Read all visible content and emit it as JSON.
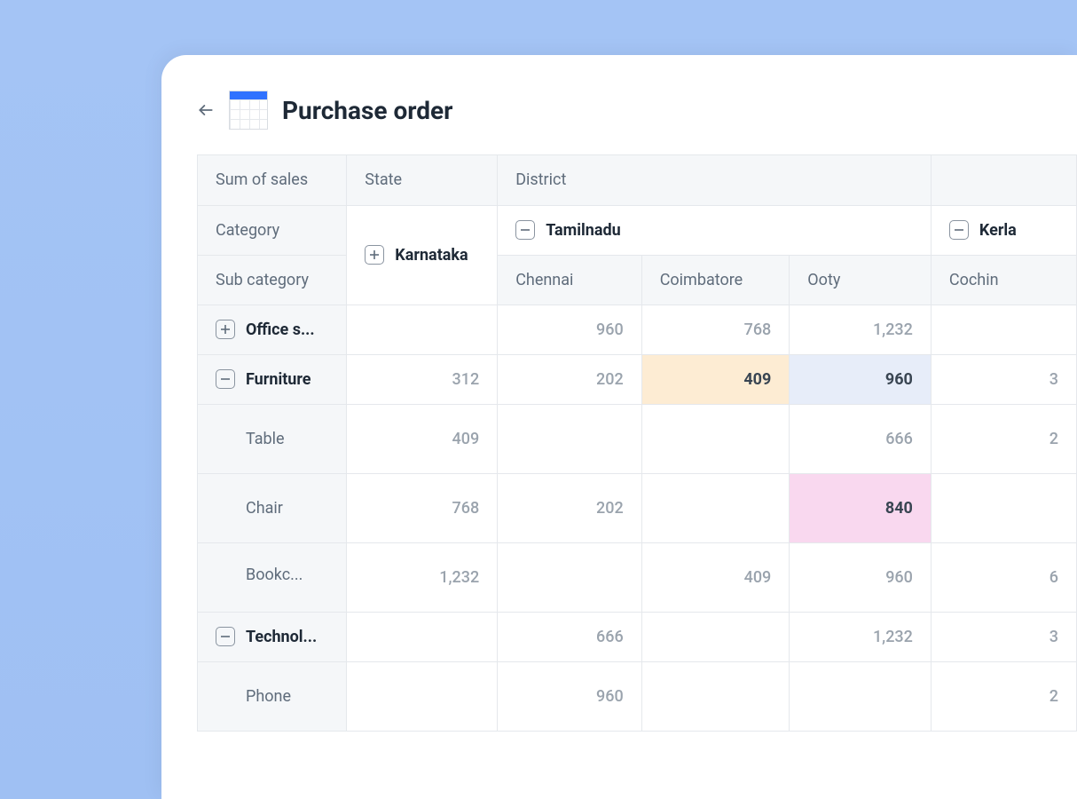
{
  "header": {
    "title": "Purchase order"
  },
  "pivot": {
    "measure_label": "Sum of sales",
    "col_axis_top": "State",
    "col_axis_sub": "District",
    "row_axis_top": "Category",
    "row_axis_sub": "Sub category",
    "col_groups": [
      {
        "name": "Karnataka",
        "expanded": false,
        "districts": []
      },
      {
        "name": "Tamilnadu",
        "expanded": true,
        "districts": [
          "Chennai",
          "Coimbatore",
          "Ooty"
        ]
      },
      {
        "name": "Kerla",
        "expanded": true,
        "districts": [
          "Cochin"
        ]
      }
    ],
    "rows": [
      {
        "category": "Office s...",
        "expanded": false,
        "values": {
          "Karnataka": "",
          "Chennai": "960",
          "Coimbatore": "768",
          "Ooty": "1,232",
          "Cochin": ""
        },
        "children": []
      },
      {
        "category": "Furniture",
        "expanded": true,
        "values": {
          "Karnataka": "312",
          "Chennai": "202",
          "Coimbatore": "409",
          "Ooty": "960",
          "Cochin": "3"
        },
        "highlights": {
          "Coimbatore": "orange",
          "Ooty": "blue"
        },
        "children": [
          {
            "name": "Table",
            "values": {
              "Karnataka": "409",
              "Chennai": "",
              "Coimbatore": "",
              "Ooty": "666",
              "Cochin": "2"
            }
          },
          {
            "name": "Chair",
            "values": {
              "Karnataka": "768",
              "Chennai": "202",
              "Coimbatore": "",
              "Ooty": "840",
              "Cochin": ""
            },
            "highlights": {
              "Ooty": "pink"
            }
          },
          {
            "name": "Bookc...",
            "values": {
              "Karnataka": "1,232",
              "Chennai": "",
              "Coimbatore": "409",
              "Ooty": "960",
              "Cochin": "6"
            }
          }
        ]
      },
      {
        "category": "Technol...",
        "expanded": true,
        "values": {
          "Karnataka": "",
          "Chennai": "666",
          "Coimbatore": "",
          "Ooty": "1,232",
          "Cochin": "3"
        },
        "children": [
          {
            "name": "Phone",
            "values": {
              "Karnataka": "",
              "Chennai": "960",
              "Coimbatore": "",
              "Ooty": "",
              "Cochin": "2"
            }
          }
        ]
      }
    ]
  }
}
